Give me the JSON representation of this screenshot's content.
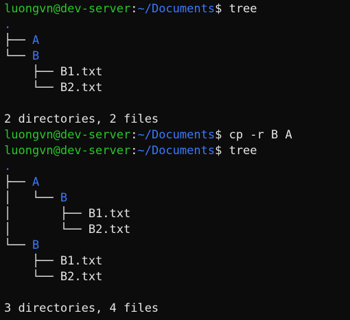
{
  "window": {
    "title": ""
  },
  "prompt": {
    "user": "luongvn@dev-server",
    "path": "~/Documents",
    "sign": "$"
  },
  "session": [
    {
      "type": "prompt",
      "command": "tree"
    },
    {
      "type": "tree-root",
      "text": "."
    },
    {
      "type": "tree",
      "indent": "├── ",
      "text": "A",
      "kind": "dir"
    },
    {
      "type": "tree",
      "indent": "└── ",
      "text": "B",
      "kind": "dir"
    },
    {
      "type": "tree",
      "indent": "    ├── ",
      "text": "B1.txt",
      "kind": "file"
    },
    {
      "type": "tree",
      "indent": "    └── ",
      "text": "B2.txt",
      "kind": "file"
    },
    {
      "type": "blank"
    },
    {
      "type": "summary",
      "text": "2 directories, 2 files"
    },
    {
      "type": "prompt",
      "command": "cp -r B A"
    },
    {
      "type": "prompt",
      "command": "tree"
    },
    {
      "type": "tree-root",
      "text": "."
    },
    {
      "type": "tree",
      "indent": "├── ",
      "text": "A",
      "kind": "dir"
    },
    {
      "type": "tree",
      "indent": "│   └── ",
      "text": "B",
      "kind": "dir"
    },
    {
      "type": "tree",
      "indent": "│       ├── ",
      "text": "B1.txt",
      "kind": "file"
    },
    {
      "type": "tree",
      "indent": "│       └── ",
      "text": "B2.txt",
      "kind": "file"
    },
    {
      "type": "tree",
      "indent": "└── ",
      "text": "B",
      "kind": "dir"
    },
    {
      "type": "tree",
      "indent": "    ├── ",
      "text": "B1.txt",
      "kind": "file"
    },
    {
      "type": "tree",
      "indent": "    └── ",
      "text": "B2.txt",
      "kind": "file"
    },
    {
      "type": "blank"
    },
    {
      "type": "summary",
      "text": "3 directories, 4 files"
    }
  ],
  "colors": {
    "background": "#0c0c0c",
    "user": "#28c828",
    "path": "#3b78ff",
    "directory": "#3b78ff",
    "text": "#e6e6e6"
  }
}
